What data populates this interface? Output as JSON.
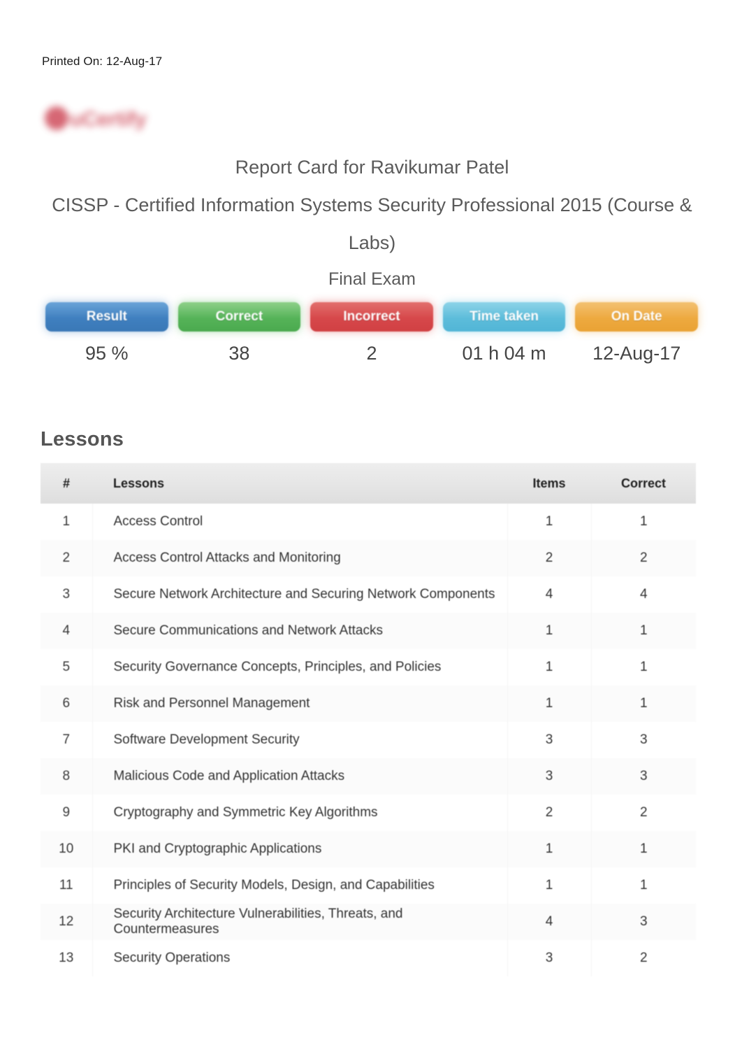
{
  "printed_on": "Printed On: 12-Aug-17",
  "logo": {
    "text": "uCertify",
    "color": "#cf4d5c"
  },
  "report": {
    "title": "Report Card for Ravikumar Patel",
    "course": "CISSP - Certified Information Systems Security Professional 2015 (Course & Labs)",
    "exam": "Final Exam"
  },
  "stats": [
    {
      "label": "Result",
      "value": "95 %",
      "color": "#3f7fbf"
    },
    {
      "label": "Correct",
      "value": "38",
      "color": "#55b358"
    },
    {
      "label": "Incorrect",
      "value": "2",
      "color": "#d6474a"
    },
    {
      "label": "Time taken",
      "value": "01 h 04 m",
      "color": "#5cbcda"
    },
    {
      "label": "On Date",
      "value": "12-Aug-17",
      "color": "#eda93f"
    }
  ],
  "lessons_section": {
    "heading": "Lessons",
    "columns": [
      "#",
      "Lessons",
      "Items",
      "Correct"
    ],
    "rows": [
      {
        "num": "1",
        "name": "Access Control",
        "items": "1",
        "correct": "1"
      },
      {
        "num": "2",
        "name": "Access Control Attacks and Monitoring",
        "items": "2",
        "correct": "2"
      },
      {
        "num": "3",
        "name": "Secure Network Architecture and Securing Network Components",
        "items": "4",
        "correct": "4"
      },
      {
        "num": "4",
        "name": "Secure Communications and Network Attacks",
        "items": "1",
        "correct": "1"
      },
      {
        "num": "5",
        "name": "Security Governance Concepts, Principles, and Policies",
        "items": "1",
        "correct": "1"
      },
      {
        "num": "6",
        "name": "Risk and Personnel Management",
        "items": "1",
        "correct": "1"
      },
      {
        "num": "7",
        "name": "Software Development Security",
        "items": "3",
        "correct": "3"
      },
      {
        "num": "8",
        "name": "Malicious Code and Application Attacks",
        "items": "3",
        "correct": "3"
      },
      {
        "num": "9",
        "name": "Cryptography and Symmetric Key Algorithms",
        "items": "2",
        "correct": "2"
      },
      {
        "num": "10",
        "name": "PKI and Cryptographic Applications",
        "items": "1",
        "correct": "1"
      },
      {
        "num": "11",
        "name": "Principles of Security Models, Design, and Capabilities",
        "items": "1",
        "correct": "1"
      },
      {
        "num": "12",
        "name": "Security Architecture Vulnerabilities, Threats, and Countermeasures",
        "items": "4",
        "correct": "3"
      },
      {
        "num": "13",
        "name": "Security Operations",
        "items": "3",
        "correct": "2"
      }
    ]
  }
}
